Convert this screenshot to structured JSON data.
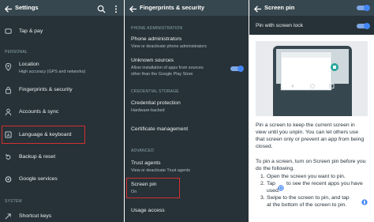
{
  "panel1": {
    "title": "Settings",
    "items": [
      {
        "label": "Tap & pay",
        "icon": "tap-pay-icon"
      },
      {
        "label": "Location",
        "sub": "High accuracy (GPS and networks)",
        "icon": "location-icon"
      },
      {
        "label": "Fingerprints & security",
        "icon": "lock-icon"
      },
      {
        "label": "Accounts & sync",
        "icon": "account-icon"
      },
      {
        "label": "Language & keyboard",
        "icon": "keyboard-icon"
      },
      {
        "label": "Backup & reset",
        "icon": "backup-icon"
      },
      {
        "label": "Google services",
        "icon": "google-icon"
      },
      {
        "label": "Shortcut keys",
        "icon": "shortcut-icon"
      }
    ],
    "sections": [
      "PERSONAL",
      "SYSTEM"
    ]
  },
  "panel2": {
    "title": "Fingerprints & security",
    "sections": [
      "PHONE ADMINISTRATION",
      "CREDENTIAL STORAGE",
      "ADVANCED"
    ],
    "items": [
      {
        "label": "Phone administrators",
        "sub": "View or deactivate phone administrators"
      },
      {
        "label": "Unknown sources",
        "sub1": "Allow installation of apps from sources",
        "sub2": "other than the Google Play Store"
      },
      {
        "label": "Credential protection",
        "sub": "Hardware-backed"
      },
      {
        "label": "Certificate management"
      },
      {
        "label": "Trust agents",
        "sub": "View or deactivate Trust agents"
      },
      {
        "label": "Screen pin",
        "sub": "On"
      },
      {
        "label": "Usage access"
      }
    ]
  },
  "panel3": {
    "title": "Screen pin",
    "toggle_label": "Pin with screen lock",
    "desc": [
      "Pin a screen to keep the current screen in",
      "view until you unpin. You can let others use",
      "that screen only or prevent an app from being",
      "closed."
    ],
    "howto": "To pin a screen, turn on Screen pin before you",
    "howto2": "do the following.",
    "steps": [
      {
        "num": "1.",
        "text": "Open the screen you want to pin."
      },
      {
        "num": "2.",
        "text1": "Tap",
        "text2": "to see the recent apps you have",
        "text3": "used."
      },
      {
        "num": "3.",
        "text1": "Swipe to the screen to pin, and tap",
        "text2": "at the bottom of the screen to pin."
      }
    ]
  },
  "colors": {
    "accent": "#4285f4",
    "highlight": "#d32f2f",
    "dark_bg": "#263238"
  }
}
